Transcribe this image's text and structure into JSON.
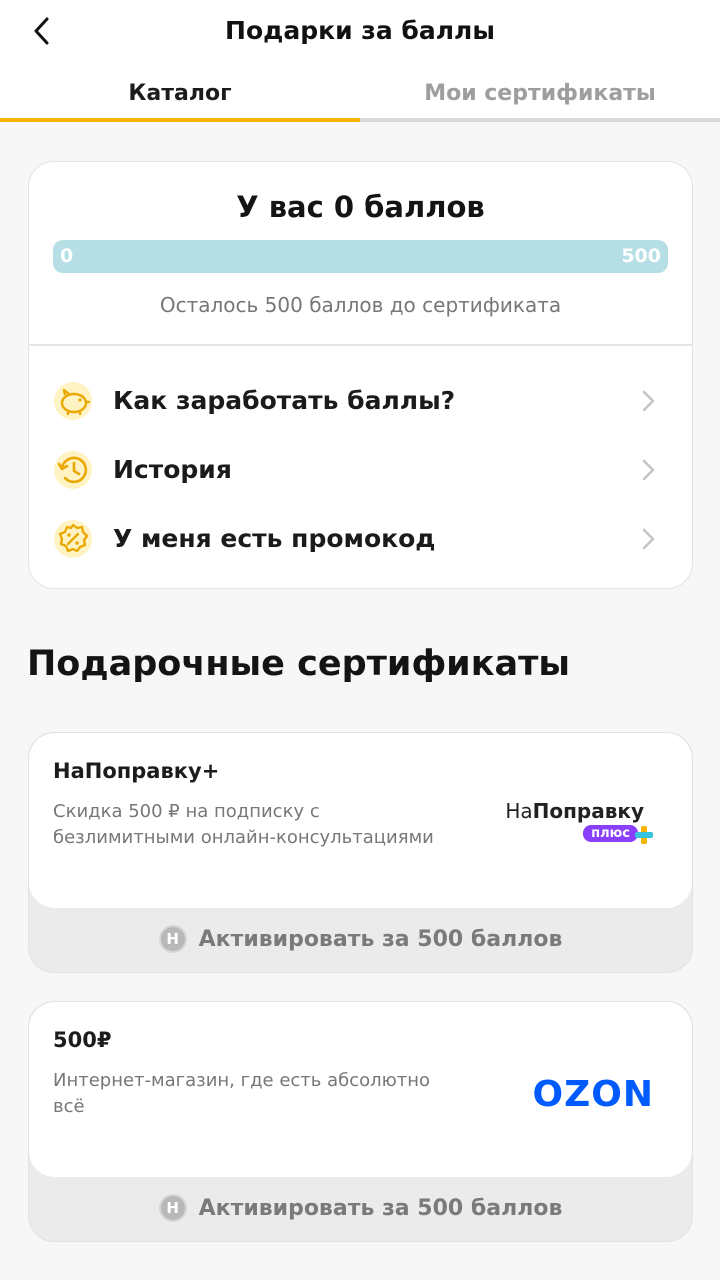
{
  "header": {
    "title": "Подарки за баллы"
  },
  "tabs": [
    {
      "label": "Каталог",
      "active": true
    },
    {
      "label": "Мои сертификаты",
      "active": false
    }
  ],
  "points": {
    "title": "У вас 0 баллов",
    "current": 0,
    "max": 500,
    "min_label": "0",
    "max_label": "500",
    "remaining": "Осталось 500 баллов до сертификата"
  },
  "menu": [
    {
      "label": "Как заработать баллы?",
      "icon": "piggy-bank-icon"
    },
    {
      "label": "История",
      "icon": "history-icon"
    },
    {
      "label": "У меня есть промокод",
      "icon": "promo-percent-icon"
    }
  ],
  "section": {
    "title": "Подарочные сертификаты"
  },
  "certificates": [
    {
      "name": "НаПоправку+",
      "description": "Скидка 500 ₽ на подписку с безлимитными онлайн-консультациями",
      "action": "Активировать за 500 баллов",
      "coin": "Н",
      "logo": {
        "prefix": "На",
        "bold": "Поправку",
        "badge": "плюс"
      }
    },
    {
      "name": "500₽",
      "description": "Интернет-магазин, где есть абсолютно всё",
      "action": "Активировать за 500 баллов",
      "coin": "Н",
      "logo": {
        "text": "OZON"
      }
    }
  ],
  "colors": {
    "accent": "#f2b705",
    "progress_bg": "#b5dfe5",
    "ozon_blue": "#005bff",
    "badge_purple": "#8a3ffc"
  }
}
